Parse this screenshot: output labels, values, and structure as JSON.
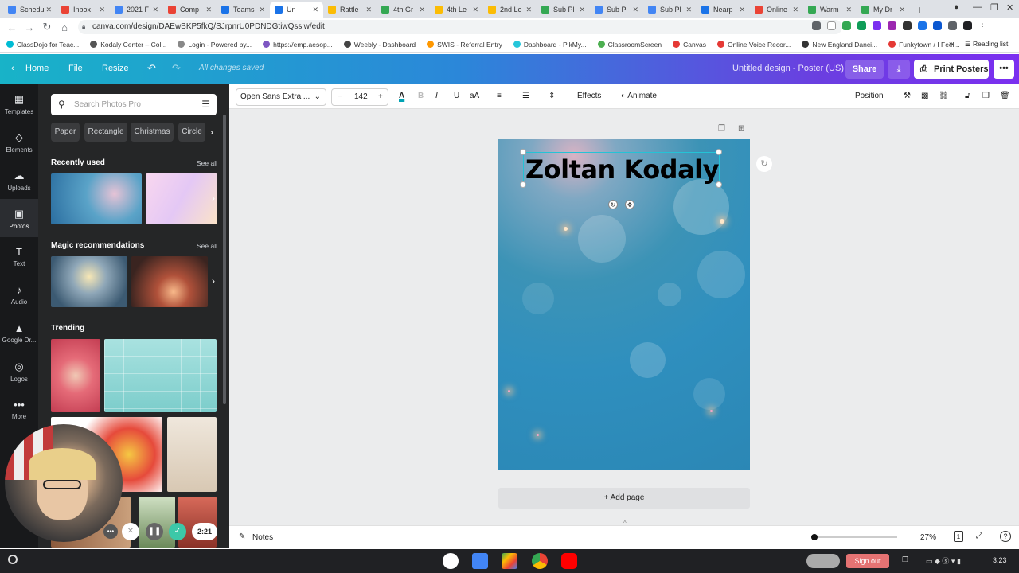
{
  "browser": {
    "tabs": [
      {
        "label": "Schedu",
        "color": "#4285f4"
      },
      {
        "label": "Inbox",
        "color": "#ea4335"
      },
      {
        "label": "2021 F",
        "color": "#4285f4"
      },
      {
        "label": "Comp",
        "color": "#ea4335"
      },
      {
        "label": "Teams",
        "color": "#1a73e8"
      },
      {
        "label": "Un",
        "color": "#1a73e8",
        "active": true
      },
      {
        "label": "Rattle",
        "color": "#fbbc04"
      },
      {
        "label": "4th Gr",
        "color": "#34a853"
      },
      {
        "label": "4th Le",
        "color": "#fbbc04"
      },
      {
        "label": "2nd Le",
        "color": "#fbbc04"
      },
      {
        "label": "Sub Pl",
        "color": "#34a853"
      },
      {
        "label": "Sub Pl",
        "color": "#4285f4"
      },
      {
        "label": "Sub Pl",
        "color": "#4285f4"
      },
      {
        "label": "Nearp",
        "color": "#1a73e8"
      },
      {
        "label": "Online",
        "color": "#ea4335"
      },
      {
        "label": "Warm",
        "color": "#34a853"
      },
      {
        "label": "My Dr",
        "color": "#34a853"
      }
    ],
    "new_tab": "+",
    "url": "canva.com/design/DAEwBKP5fkQ/SJrpnrU0PDNDGtiwQsslw/edit",
    "bookmarks": [
      {
        "label": "ClassDojo for Teac...",
        "color": "#00bcd4"
      },
      {
        "label": "Kodaly Center – Col...",
        "color": "#555"
      },
      {
        "label": "Login - Powered by...",
        "color": "#888"
      },
      {
        "label": "https://emp.aesop...",
        "color": "#7e57c2"
      },
      {
        "label": "Weebly - Dashboard",
        "color": "#444"
      },
      {
        "label": "SWIS - Referral Entry",
        "color": "#ff9800"
      },
      {
        "label": "Dashboard - PikMy...",
        "color": "#26c6da"
      },
      {
        "label": "ClassroomScreen",
        "color": "#4caf50"
      },
      {
        "label": "Canvas",
        "color": "#e53935"
      },
      {
        "label": "Online Voice Recor...",
        "color": "#e53935"
      },
      {
        "label": "New England Danci...",
        "color": "#333"
      },
      {
        "label": "Funkytown / I Feel...",
        "color": "#e53935"
      }
    ],
    "bookmarks_more": "»",
    "reading_list": "Reading list"
  },
  "topbar": {
    "home": "Home",
    "file": "File",
    "resize": "Resize",
    "saved": "All changes saved",
    "design_title": "Untitled design - Poster (US)",
    "share": "Share",
    "print": "Print Posters",
    "more": "•••"
  },
  "leftnav": [
    {
      "label": "Templates",
      "icon": "▦"
    },
    {
      "label": "Elements",
      "icon": "◇"
    },
    {
      "label": "Uploads",
      "icon": "☁"
    },
    {
      "label": "Photos",
      "icon": "▣",
      "active": true
    },
    {
      "label": "Text",
      "icon": "T"
    },
    {
      "label": "Audio",
      "icon": "♪"
    },
    {
      "label": "Google Dr...",
      "icon": "▲"
    },
    {
      "label": "Logos",
      "icon": "◎"
    },
    {
      "label": "More",
      "icon": "•••"
    }
  ],
  "panel": {
    "search_placeholder": "Search Photos Pro",
    "chips": [
      "Paper",
      "Rectangle",
      "Christmas",
      "Circle"
    ],
    "recently_used": "Recently used",
    "magic": "Magic recommendations",
    "trending": "Trending",
    "see_all": "See all"
  },
  "toolbar": {
    "font": "Open Sans Extra ...",
    "size": "142",
    "effects": "Effects",
    "animate": "Animate",
    "position": "Position"
  },
  "canvas": {
    "title": "Zoltan Kodaly",
    "add_page": "+ Add page"
  },
  "bottombar": {
    "notes": "Notes",
    "zoom": "27%",
    "page": "1",
    "zoom_fraction": 0.27
  },
  "recorder": {
    "timer": "2:21"
  },
  "taskbar": {
    "sign_out": "Sign out",
    "time": "3:23"
  },
  "colors": {
    "accent_cyan": "#24c3d6",
    "sidebar_bg": "#18191b",
    "panel_bg": "#252627"
  }
}
